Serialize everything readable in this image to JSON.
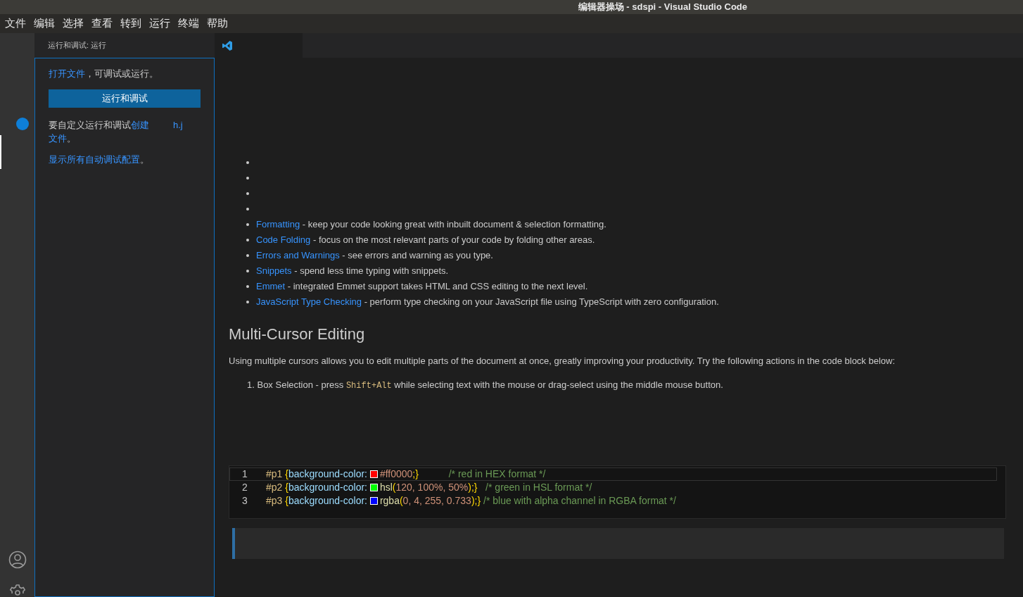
{
  "window": {
    "title": "编辑器操场 - sdspi - Visual Studio Code"
  },
  "menu": [
    "文件",
    "编辑",
    "选择",
    "查看",
    "转到",
    "运行",
    "终端",
    "帮助"
  ],
  "sidebar": {
    "title": "运行和调试: 运行",
    "open_file": {
      "link": "打开文件",
      "text": "，可调试或运行。"
    },
    "run_button": "运行和调试",
    "customize": {
      "text": "要自定义运行和调试",
      "link": "创建",
      "fragment": "h.j",
      "link2": "文件",
      "end": "。"
    },
    "show_all": {
      "link": "显示所有自动调试配置",
      "end": "。"
    }
  },
  "features": [
    {
      "link": "Formatting",
      "text": "- keep your code looking great with inbuilt document & selection formatting."
    },
    {
      "link": "Code Folding",
      "text": "- focus on the most relevant parts of your code by folding other areas."
    },
    {
      "link": "Errors and Warnings",
      "text": "- see errors and warning as you type."
    },
    {
      "link": "Snippets",
      "text": "- spend less time typing with snippets."
    },
    {
      "link": "Emmet",
      "text": "- integrated Emmet support takes HTML and CSS editing to the next level."
    },
    {
      "link": "JavaScript Type Checking",
      "text": "- perform type checking on your JavaScript file using TypeScript with zero configuration."
    }
  ],
  "heading": "Multi-Cursor Editing",
  "paragraph": "Using multiple cursors allows you to edit multiple parts of the document at once, greatly improving your productivity. Try the following actions in the code block below:",
  "steps": [
    {
      "number": "1.",
      "parts": [
        {
          "kind": "text",
          "text": "Box Selection - press "
        },
        {
          "kind": "key",
          "text": "Shift+Alt"
        },
        {
          "kind": "text",
          "text": " while selecting text with the mouse or drag-select using the middle mouse button."
        }
      ]
    }
  ],
  "code": {
    "lines": [
      {
        "number": "1",
        "selected": true,
        "color": "#ff0000",
        "tokens": [
          {
            "kind": "selector",
            "text": "#p1"
          },
          {
            "kind": "brace",
            "text": " {"
          },
          {
            "kind": "property",
            "text": "background-color: "
          },
          {
            "kind": "swatch"
          },
          {
            "kind": "value",
            "text": "#ff0000"
          },
          {
            "kind": "brace",
            "text": ";}"
          },
          {
            "kind": "comment",
            "text": "           /* red in HEX format */"
          }
        ]
      },
      {
        "number": "2",
        "selected": false,
        "color": "#00ff00",
        "tokens": [
          {
            "kind": "selector",
            "text": "#p2"
          },
          {
            "kind": "brace",
            "text": " {"
          },
          {
            "kind": "property",
            "text": "background-color: "
          },
          {
            "kind": "swatch"
          },
          {
            "kind": "func",
            "text": "hsl"
          },
          {
            "kind": "brace",
            "text": "("
          },
          {
            "kind": "value",
            "text": "120, 100%, 50%"
          },
          {
            "kind": "brace",
            "text": ");}"
          },
          {
            "kind": "comment",
            "text": "   /* green in HSL format */"
          }
        ]
      },
      {
        "number": "3",
        "selected": false,
        "color": "#0004ff",
        "tokens": [
          {
            "kind": "selector",
            "text": "#p3"
          },
          {
            "kind": "brace",
            "text": " {"
          },
          {
            "kind": "property",
            "text": "background-color: "
          },
          {
            "kind": "swatch"
          },
          {
            "kind": "func",
            "text": "rgba"
          },
          {
            "kind": "brace",
            "text": "("
          },
          {
            "kind": "value",
            "text": "0, 4, 255, 0.733"
          },
          {
            "kind": "brace",
            "text": ");}"
          },
          {
            "kind": "comment",
            "text": " /* blue with alpha channel in RGBA format */"
          }
        ]
      }
    ]
  }
}
